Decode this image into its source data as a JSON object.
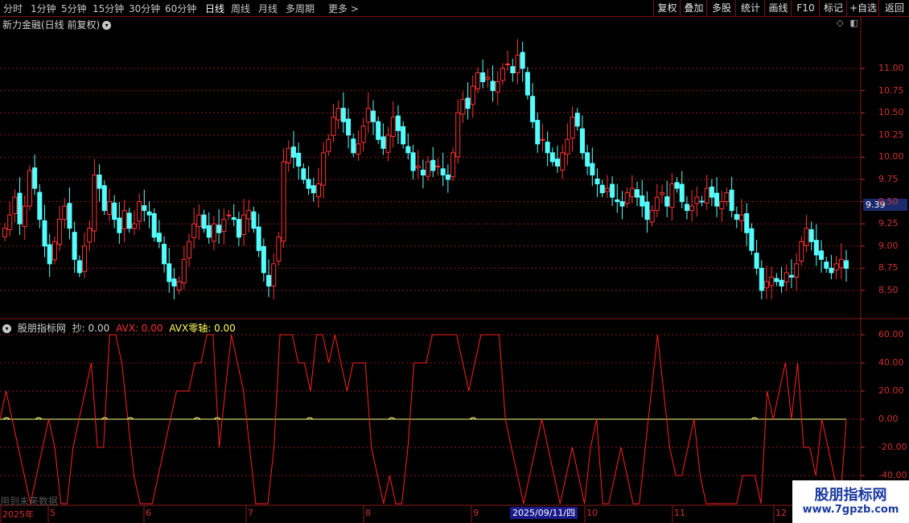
{
  "toolbar": {
    "periods": [
      {
        "label": "分时",
        "active": false
      },
      {
        "label": "1分钟",
        "active": false
      },
      {
        "label": "5分钟",
        "active": false
      },
      {
        "label": "15分钟",
        "active": false
      },
      {
        "label": "30分钟",
        "active": false
      },
      {
        "label": "60分钟",
        "active": false
      },
      {
        "label": "日线",
        "active": true
      },
      {
        "label": "周线",
        "active": false
      },
      {
        "label": "月线",
        "active": false
      },
      {
        "label": "多周期",
        "active": false
      },
      {
        "label": "更多 >",
        "active": false
      }
    ],
    "right_buttons": [
      "复权",
      "叠加",
      "多股",
      "统计",
      "画线",
      "F10",
      "标记",
      "+自选",
      "返回"
    ]
  },
  "stock": {
    "title": "新力金融(日线 前复权)",
    "current_price_tag": "9.39"
  },
  "indicator": {
    "name": "股朋指标网",
    "chao_label": "抄: 0.00",
    "avx_label": "AVX: 0.00",
    "avx_zero_label": "AVX零轴: 0.00"
  },
  "price_axis": {
    "ticks": [
      "11.00",
      "10.75",
      "10.50",
      "10.25",
      "10.00",
      "9.75",
      "9.50",
      "9.25",
      "9.00",
      "8.75",
      "8.50"
    ]
  },
  "indicator_axis": {
    "ticks": [
      "60.00",
      "40.00",
      "20.00",
      "0.00",
      "-20.00",
      "-40.00"
    ]
  },
  "date_axis": {
    "labels": [
      "2025年",
      "5",
      "6",
      "7",
      "8",
      "9",
      "10",
      "11",
      "12"
    ],
    "hover_date": "2025/09/11/四"
  },
  "watermark_text": "用到未来数据",
  "brand": {
    "name": "股朋指标网",
    "url": "www.7gpzb.com"
  },
  "colors": {
    "up": "#ff3333",
    "down": "#54ffff",
    "indicator_line": "#ff2020",
    "zero_line": "#ffff80",
    "grid": "#8b1a1a"
  },
  "chart_data": [
    {
      "type": "candlestick",
      "title": "新力金融(日线 前复权)",
      "ylim": [
        8.4,
        11.3
      ],
      "x_labels": [
        "2025年",
        "5",
        "6",
        "7",
        "8",
        "9",
        "10",
        "11",
        "12"
      ],
      "close": [
        9.2,
        9.35,
        9.55,
        9.25,
        9.45,
        9.85,
        9.65,
        9.3,
        9.0,
        8.8,
        9.05,
        9.3,
        9.45,
        9.2,
        8.85,
        8.7,
        9.0,
        9.2,
        9.8,
        9.65,
        9.4,
        9.5,
        9.3,
        9.15,
        9.4,
        9.2,
        9.25,
        9.5,
        9.4,
        9.35,
        9.1,
        9.05,
        8.8,
        8.6,
        8.55,
        8.6,
        8.85,
        9.05,
        9.25,
        9.35,
        9.2,
        9.1,
        9.25,
        9.15,
        9.3,
        9.35,
        9.3,
        9.1,
        9.35,
        9.4,
        9.2,
        8.95,
        8.7,
        8.55,
        8.8,
        9.1,
        9.95,
        10.1,
        10.0,
        9.9,
        9.75,
        9.65,
        9.6,
        9.7,
        10.05,
        10.2,
        10.45,
        10.55,
        10.4,
        10.25,
        10.05,
        10.15,
        10.35,
        10.55,
        10.4,
        10.2,
        10.1,
        10.25,
        10.45,
        10.3,
        10.15,
        10.05,
        9.85,
        9.9,
        9.8,
        9.95,
        9.85,
        9.9,
        9.8,
        9.75,
        10.05,
        10.5,
        10.65,
        10.55,
        10.8,
        10.95,
        10.85,
        10.9,
        10.75,
        10.85,
        11.0,
        11.05,
        10.95,
        11.15,
        11.0,
        10.7,
        10.4,
        10.15,
        10.2,
        10.05,
        9.95,
        9.9,
        10.05,
        10.2,
        10.45,
        10.35,
        10.05,
        9.9,
        9.8,
        9.7,
        9.6,
        9.65,
        9.55,
        9.5,
        9.45,
        9.6,
        9.65,
        9.55,
        9.45,
        9.3,
        9.4,
        9.55,
        9.6,
        9.45,
        9.7,
        9.65,
        9.5,
        9.4,
        9.45,
        9.55,
        9.5,
        9.65,
        9.55,
        9.45,
        9.5,
        9.6,
        9.4,
        9.3,
        9.35,
        9.15,
        8.95,
        8.75,
        8.5,
        8.6,
        8.65,
        8.6,
        8.55,
        8.7,
        8.65,
        8.8,
        9.05,
        9.2,
        9.05,
        8.9,
        8.85,
        8.75,
        8.7,
        8.8,
        8.85,
        8.75
      ],
      "series": [
        {
          "name": "抄",
          "values": [
            0,
            20,
            0,
            -20,
            -40,
            -60,
            -40,
            -20,
            0,
            -20,
            -60,
            -60,
            -20,
            0,
            20,
            40,
            -20,
            -20,
            60,
            60,
            40,
            0,
            -40,
            -60,
            -60,
            -60,
            -40,
            -20,
            0,
            20,
            20,
            20,
            40,
            40,
            60,
            60,
            -20,
            20,
            60,
            40,
            20,
            -20,
            -60,
            -60,
            -60,
            -20,
            60,
            60,
            60,
            40,
            40,
            20,
            60,
            60,
            40,
            60,
            40,
            20,
            40,
            40,
            40,
            -20,
            -40,
            -60,
            -40,
            -60,
            -60,
            -20,
            40,
            40,
            40,
            60,
            60,
            60,
            60,
            60,
            40,
            20,
            40,
            60,
            60,
            60,
            60,
            0,
            -20,
            -40,
            -60,
            -40,
            -20,
            0,
            -20,
            -40,
            -60,
            -40,
            -20,
            -40,
            -60,
            -20,
            0,
            -60,
            -60,
            -40,
            -20,
            -40,
            -60,
            -60,
            -20,
            20,
            60,
            20,
            -20,
            -40,
            -40,
            -20,
            0,
            -40,
            -60,
            -60,
            -60,
            -60,
            -60,
            -60,
            -40,
            -40,
            -40,
            -60,
            20,
            0,
            20,
            40,
            0,
            40,
            -20,
            -20,
            -40,
            0,
            -20,
            -40,
            -60,
            0
          ]
        },
        {
          "name": "AVX",
          "values": [
            0
          ]
        },
        {
          "name": "AVX零轴",
          "values": [
            0
          ]
        }
      ],
      "ylim_indicator": [
        -60,
        60
      ]
    }
  ]
}
